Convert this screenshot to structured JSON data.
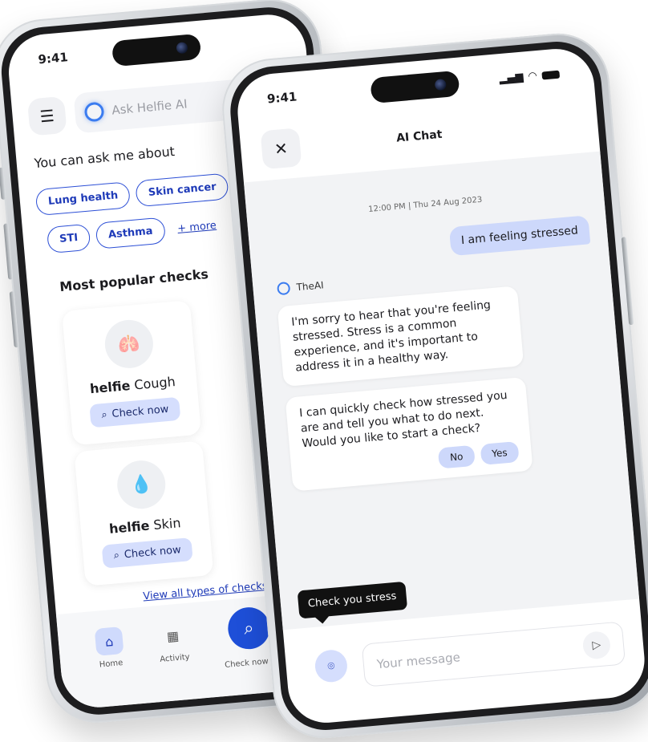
{
  "status": {
    "time_back": "9:41",
    "time_front": "9:41"
  },
  "home": {
    "ask_placeholder": "Ask Helfie AI",
    "ask_heading": "You can ask me about",
    "chips_row1": [
      "Lung health",
      "Skin cancer"
    ],
    "chips_row2": [
      "STI",
      "Asthma"
    ],
    "more_label": "+ more",
    "popular_heading": "Most popular checks",
    "cards": [
      {
        "brand": "helfie",
        "name": "Cough",
        "button": "Check now"
      },
      {
        "brand": "helfie",
        "name": "Skin",
        "button": "Check now"
      }
    ],
    "view_all": "View all types of checks",
    "tabs": [
      {
        "label": "Home",
        "icon": "home-icon"
      },
      {
        "label": "Activity",
        "icon": "grid-icon"
      },
      {
        "label": "Check now",
        "icon": "search-icon"
      }
    ]
  },
  "chat": {
    "title": "AI Chat",
    "timestamp": "12:00 PM | Thu 24 Aug 2023",
    "user_message": "I am feeling stressed",
    "ai_name": "TheAI",
    "ai_message_1": "I'm sorry to hear that you're feeling stressed. Stress is a common experience, and it's important to address it in a healthy way.",
    "ai_message_2": "I can quickly check how stressed you are and tell you what to do next. Would you like to start a check?",
    "option_no": "No",
    "option_yes": "Yes",
    "tooltip": "Check you stress",
    "input_placeholder": "Your message"
  },
  "colors": {
    "accent": "#1e4fd8",
    "chip_border": "#2c4fd6",
    "bubble": "#cdd8fb"
  }
}
